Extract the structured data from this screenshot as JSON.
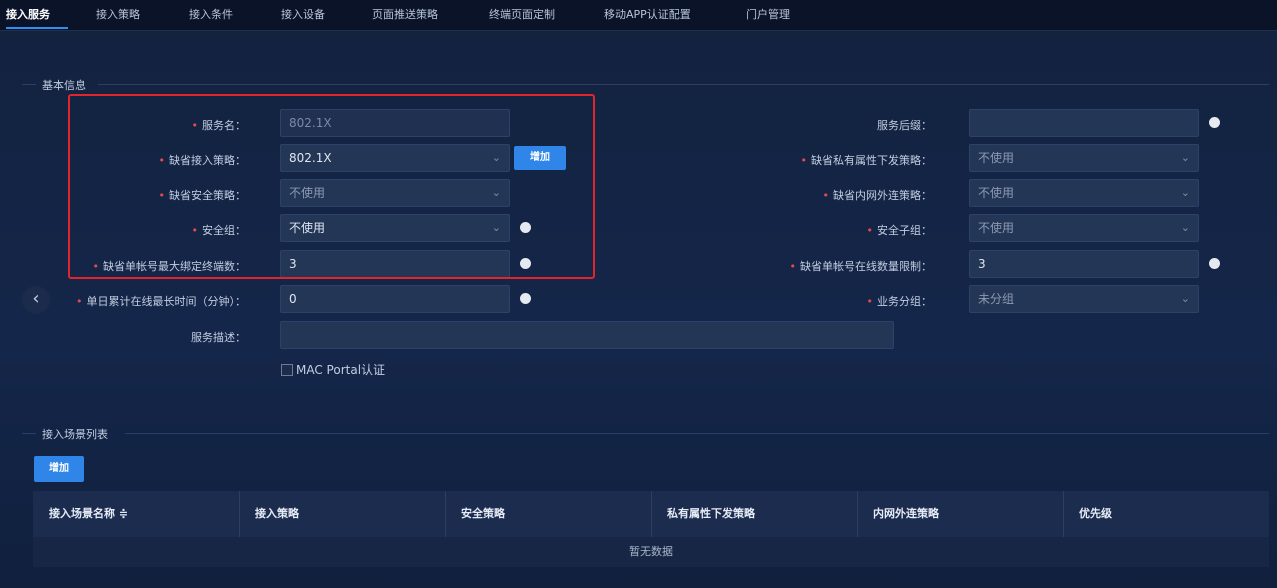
{
  "tabs": [
    {
      "label": "接入服务",
      "active": true
    },
    {
      "label": "接入策略"
    },
    {
      "label": "接入条件"
    },
    {
      "label": "接入设备"
    },
    {
      "label": "页面推送策略"
    },
    {
      "label": "终端页面定制"
    },
    {
      "label": "移动APP认证配置"
    },
    {
      "label": "门户管理"
    }
  ],
  "basic_info": {
    "title": "基本信息",
    "service_name": {
      "label": "服务名：",
      "value": "802.1X"
    },
    "default_access_policy": {
      "label": "缺省接入策略：",
      "value": "802.1X",
      "add_label": "增加"
    },
    "default_security_policy": {
      "label": "缺省安全策略：",
      "value": "不使用"
    },
    "security_group": {
      "label": "安全组：",
      "value": "不使用"
    },
    "max_bind_terminals": {
      "label": "缺省单帐号最大绑定终端数：",
      "value": "3"
    },
    "daily_online_time": {
      "label": "单日累计在线最长时间（分钟）：",
      "value": "0"
    },
    "service_desc": {
      "label": "服务描述：",
      "value": ""
    },
    "mac_portal": {
      "label": "MAC Portal认证",
      "checked": false
    },
    "service_suffix": {
      "label": "服务后缀：",
      "value": ""
    },
    "default_private_attr_policy": {
      "label": "缺省私有属性下发策略：",
      "value": "不使用"
    },
    "default_intranet_policy": {
      "label": "缺省内网外连策略：",
      "value": "不使用"
    },
    "security_subgroup": {
      "label": "安全子组：",
      "value": "不使用"
    },
    "online_limit": {
      "label": "缺省单帐号在线数量限制：",
      "value": "3"
    },
    "business_group": {
      "label": "业务分组：",
      "value": "未分组"
    }
  },
  "scene_list": {
    "title": "接入场景列表",
    "add_label": "增加",
    "columns": [
      "接入场景名称 ≑",
      "接入策略",
      "安全策略",
      "私有属性下发策略",
      "内网外连策略",
      "优先级"
    ],
    "empty_text": "暂无数据"
  },
  "colors": {
    "accent": "#2f86e8",
    "highlight_box": "#e0262b",
    "required": "#e84a4a"
  }
}
